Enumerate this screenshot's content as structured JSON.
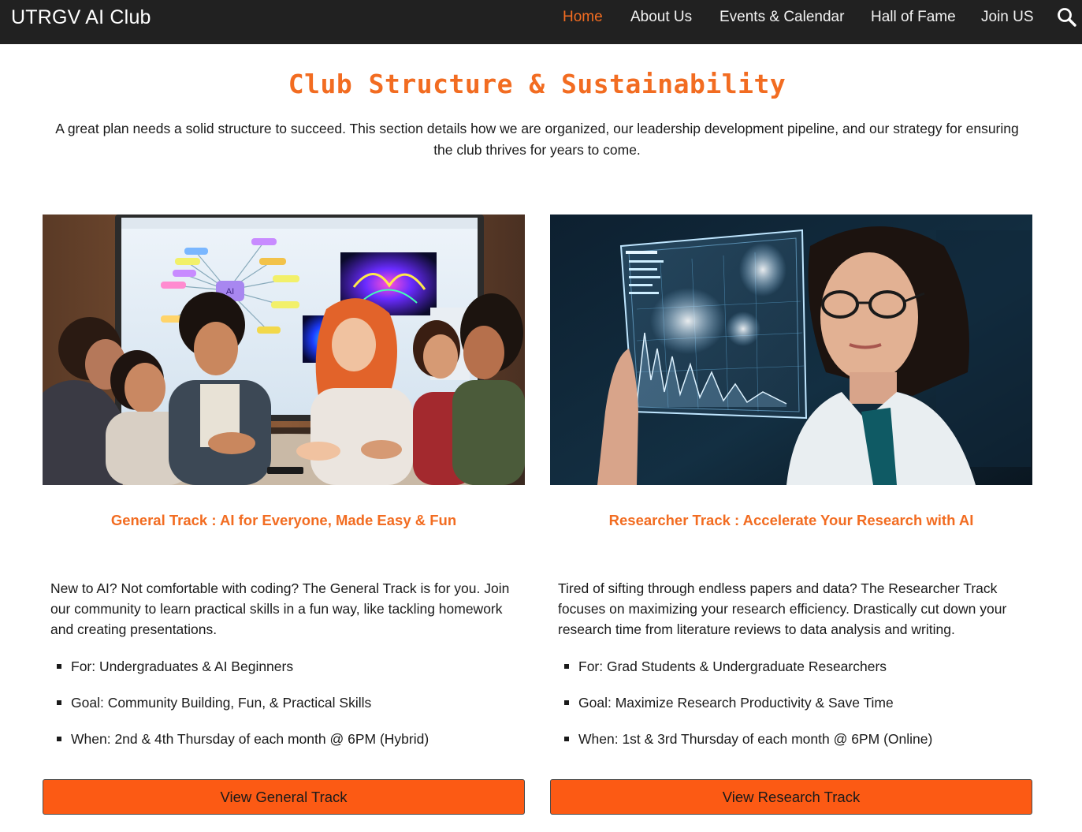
{
  "site": {
    "brand": "UTRGV AI Club",
    "nav": [
      {
        "label": "Home",
        "active": true
      },
      {
        "label": "About Us",
        "active": false
      },
      {
        "label": "Events & Calendar",
        "active": false
      },
      {
        "label": "Hall of Fame",
        "active": false
      },
      {
        "label": "Join US",
        "active": false
      }
    ],
    "search_icon": "search-icon"
  },
  "section": {
    "title": "Club Structure & Sustainability",
    "intro": "A great plan needs a solid structure to succeed. This section details how we are organized, our leadership development pipeline, and our strategy for ensuring the club thrives for years to come."
  },
  "tracks": [
    {
      "title": "General Track : AI for Everyone, Made Easy & Fun",
      "description": "New to AI? Not comfortable with coding? The General Track is for you. Join our community to learn practical skills in a fun way, like tackling homework and creating presentations.",
      "bullets": [
        "For: Undergraduates & AI Beginners",
        "Goal: Community Building, Fun, & Practical Skills",
        "When: 2nd & 4th Thursday of each month @ 6PM (Hybrid)"
      ],
      "button": "View General Track",
      "image_text": "AI"
    },
    {
      "title": "Researcher Track : Accelerate Your Research with AI",
      "description": "Tired of sifting through endless papers and data? The Researcher Track focuses on maximizing your research efficiency. Drastically cut down your research time from literature reviews to data analysis and writing.",
      "bullets": [
        "For: Grad Students & Undergraduate Researchers",
        "Goal: Maximize Research Productivity & Save Time",
        "When: 1st & 3rd Thursday of each month @ 6PM (Online)"
      ],
      "button": "View Research Track"
    }
  ],
  "colors": {
    "accent": "#f26c21",
    "button": "#fc5a14",
    "topbar": "#212121"
  }
}
